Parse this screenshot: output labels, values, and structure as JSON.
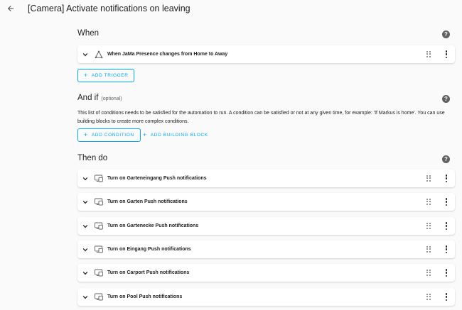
{
  "header": {
    "title": "[Camera] Activate notifications on leaving"
  },
  "when": {
    "title": "When",
    "trigger_label": "When JaMa Presence changes from Home to Away",
    "add_trigger_label": "ADD TRIGGER"
  },
  "and_if": {
    "title": "And if",
    "subtitle": "(optional)",
    "description": "This list of conditions needs to be satisfied for the automation to run. A condition can be satisfied or not at any given time, for example: 'If Markus is home'. You can use building blocks to create more complex conditions.",
    "add_condition_label": "ADD CONDITION",
    "add_building_block_label": "ADD BUILDING BLOCK"
  },
  "then_do": {
    "title": "Then do",
    "actions": [
      {
        "label": "Turn on Garteneingang Push notifications"
      },
      {
        "label": "Turn on Garten Push notifications"
      },
      {
        "label": "Turn on Gartenecke Push notifications"
      },
      {
        "label": "Turn on Eingang Push notifications"
      },
      {
        "label": "Turn on Carport Push notifications"
      },
      {
        "label": "Turn on Pool Push notifications"
      }
    ]
  },
  "help_glyph": "?",
  "icons": {
    "back": "arrow-left-icon",
    "help": "help-circle-icon",
    "chevron": "chevron-down-icon",
    "trigger": "state-change-icon",
    "action": "device-icon",
    "drag": "drag-handle-icon",
    "menu": "more-vertical-icon"
  },
  "colors": {
    "accent": "#03a9f4",
    "background": "#fafafa",
    "card": "#ffffff",
    "icon": "#616161"
  }
}
